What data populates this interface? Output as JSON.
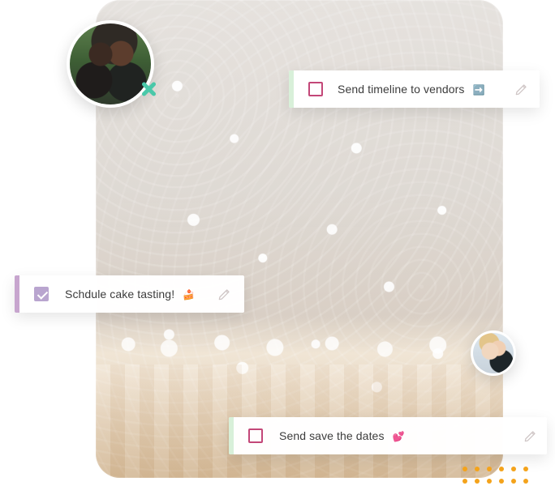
{
  "tasks": {
    "top": {
      "text": "Send timeline to vendors",
      "emoji": "➡️"
    },
    "middle": {
      "text": "Schdule cake tasting!",
      "emoji": "🍰"
    },
    "bottom": {
      "text": "Send save the dates",
      "emoji": "💕"
    }
  },
  "colors": {
    "accent_green": "#d8f0d9",
    "accent_purple": "#c7a5ce",
    "checkbox_pink": "#c34778",
    "checkbox_checked": "#b9a5cf",
    "decorative_orange": "#f4a31b",
    "x_mark_green": "#49c8a9"
  },
  "icons": {
    "top_checkbox": "checkbox-empty-icon",
    "middle_checkbox": "checkbox-checked-icon",
    "bottom_checkbox": "checkbox-empty-icon",
    "edit": "pencil-icon",
    "x_mark": "x-icon"
  }
}
